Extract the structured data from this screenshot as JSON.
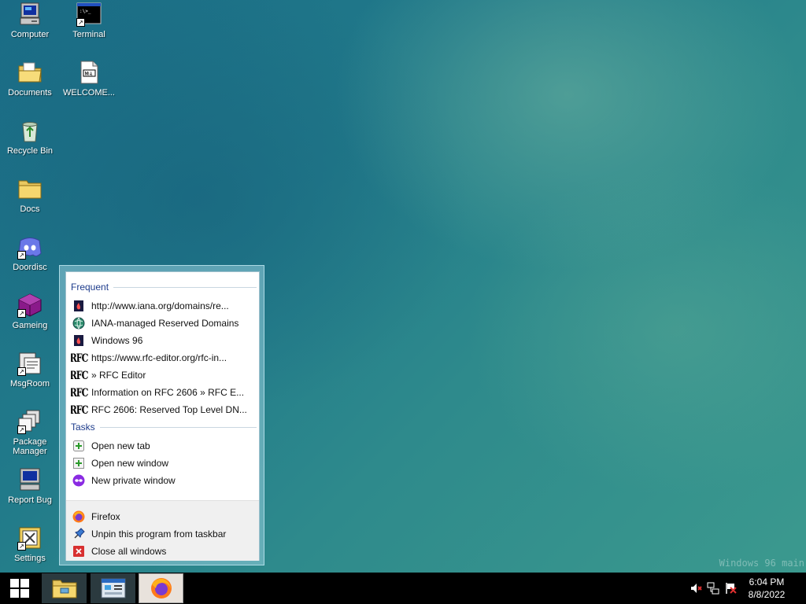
{
  "desktop": {
    "icons": [
      {
        "label": "Computer"
      },
      {
        "label": "Terminal"
      },
      {
        "label": "Documents"
      },
      {
        "label": "WELCOME..."
      },
      {
        "label": "Recycle Bin"
      },
      {
        "label": "Docs"
      },
      {
        "label": "Doordisc"
      },
      {
        "label": "Gameing"
      },
      {
        "label": "MsgRoom"
      },
      {
        "label": "Package Manager"
      },
      {
        "label": "Report Bug"
      },
      {
        "label": "Settings"
      }
    ],
    "watermark": "Windows 96 main"
  },
  "jumplist": {
    "frequent_title": "Frequent",
    "frequent": [
      {
        "label": "http://www.iana.org/domains/re...",
        "icon": "w96-page-icon"
      },
      {
        "label": "IANA-managed Reserved Domains",
        "icon": "globe-icon"
      },
      {
        "label": "Windows 96",
        "icon": "w96-page-icon"
      },
      {
        "label": "https://www.rfc-editor.org/rfc-in...",
        "icon": "rfc-icon"
      },
      {
        "label": "» RFC Editor",
        "icon": "rfc-icon"
      },
      {
        "label": "Information on RFC 2606 » RFC E...",
        "icon": "rfc-icon"
      },
      {
        "label": "RFC 2606: Reserved Top Level DN...",
        "icon": "rfc-icon"
      }
    ],
    "rfc_glyph": "RFC",
    "tasks_title": "Tasks",
    "tasks": [
      {
        "label": "Open new tab",
        "icon": "new-tab-icon"
      },
      {
        "label": "Open new window",
        "icon": "new-window-icon"
      },
      {
        "label": "New private window",
        "icon": "private-window-icon"
      }
    ],
    "footer": [
      {
        "label": "Firefox",
        "icon": "firefox-icon"
      },
      {
        "label": "Unpin this program from taskbar",
        "icon": "unpin-icon"
      },
      {
        "label": "Close all windows",
        "icon": "close-icon"
      }
    ]
  },
  "taskbar": {
    "clock_time": "6:04 PM",
    "clock_date": "8/8/2022"
  }
}
